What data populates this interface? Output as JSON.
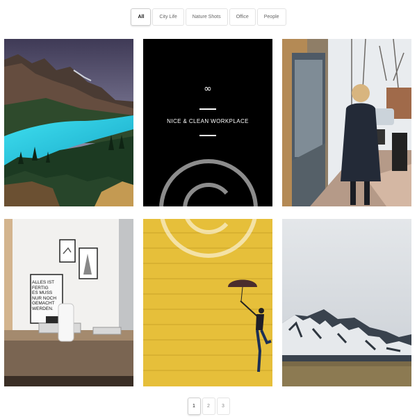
{
  "filters": {
    "items": [
      {
        "label": "All",
        "active": true
      },
      {
        "label": "City Life",
        "active": false
      },
      {
        "label": "Nature Shots",
        "active": false
      },
      {
        "label": "Office",
        "active": false
      },
      {
        "label": "People",
        "active": false
      }
    ]
  },
  "gallery": {
    "items": [
      {
        "subject": "mountain-lake-photo"
      },
      {
        "subject": "featured-overlay",
        "overlay_title": "NICE & CLEAN WORKPLACE",
        "overlay_icon": "infinity-icon",
        "overlay_action_icon": "expand-icon"
      },
      {
        "subject": "city-street-woman-photo"
      },
      {
        "subject": "office-desk-photo",
        "poster_text": [
          "ALLES IST",
          "FERTIG",
          "ES MUSS",
          "NUR NOCH",
          "GEMACHT",
          "WERDEN."
        ]
      },
      {
        "subject": "woman-umbrella-yellow-wall-photo"
      },
      {
        "subject": "snowy-mountains-photo"
      }
    ]
  },
  "watermark": {
    "icon": "copyright-icon"
  },
  "pagination": {
    "pages": [
      {
        "label": "1",
        "active": true
      },
      {
        "label": "2",
        "active": false
      },
      {
        "label": "3",
        "active": false
      }
    ]
  },
  "colors": {
    "overlay_bg": "#000000",
    "lake": "#2fd0e6",
    "wall_yellow": "#e6bf3a",
    "sky_grey": "#d9dde1"
  }
}
